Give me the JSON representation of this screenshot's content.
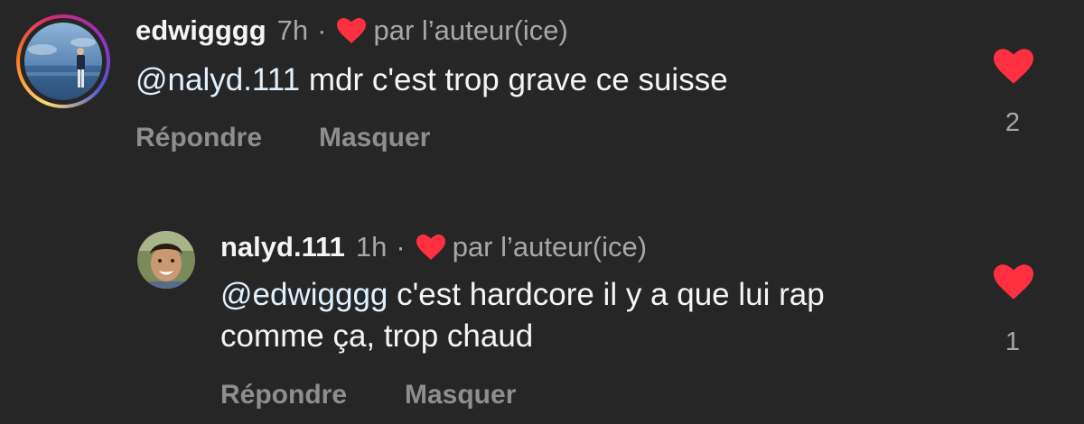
{
  "comments": [
    {
      "username": "edwigggg",
      "time": "7h",
      "separator": "·",
      "liked_by_author": "par l’auteur(ice)",
      "mention": "@nalyd.111",
      "text": " mdr c'est trop grave ce suisse",
      "reply_label": "Répondre",
      "hide_label": "Masquer",
      "like_count": "2"
    },
    {
      "username": "nalyd.111",
      "time": "1h",
      "separator": "·",
      "liked_by_author": "par l’auteur(ice)",
      "mention": "@edwigggg",
      "text_line1": " c'est hardcore il y a que lui rap",
      "text_line2": "comme ça, trop chaud",
      "reply_label": "Répondre",
      "hide_label": "Masquer",
      "like_count": "1"
    }
  ],
  "colors": {
    "background": "#262626",
    "heart": "#ff3040",
    "secondary_text": "#a8a8a8",
    "action_text": "#8e8e8e",
    "mention": "#e0f1ff"
  },
  "icons": {
    "liked_indicator": "heart-filled-icon",
    "like_button": "heart-filled-icon"
  }
}
